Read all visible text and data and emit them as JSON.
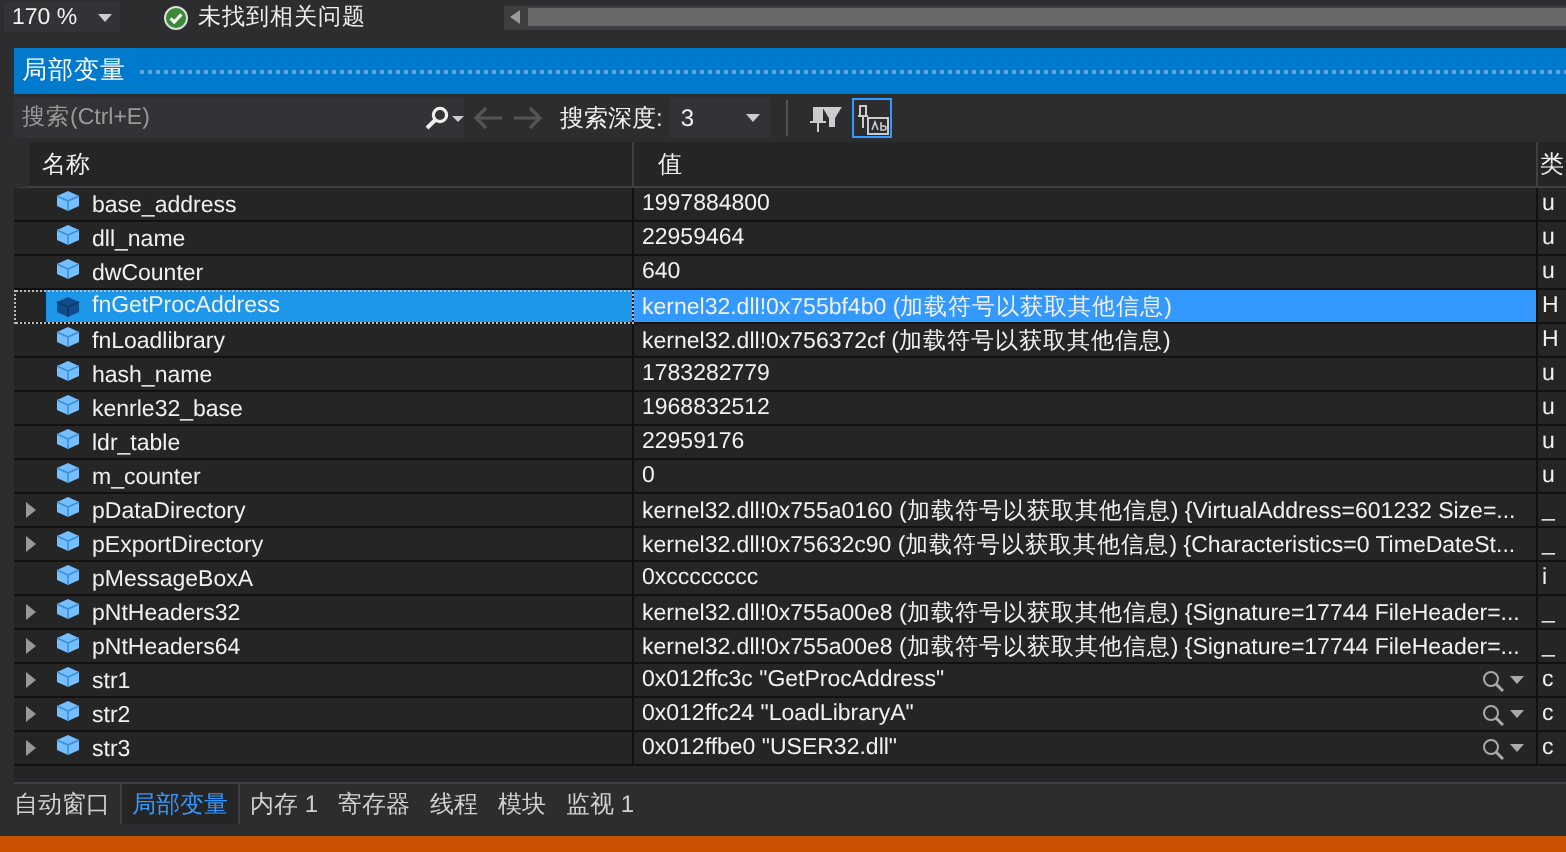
{
  "top_bar": {
    "zoom": "170 %",
    "status": "未找到相关问题"
  },
  "panel": {
    "title": "局部变量"
  },
  "toolbar": {
    "search_placeholder": "搜索(Ctrl+E)",
    "depth_label": "搜索深度:",
    "depth": "3",
    "view_buttons": [
      {
        "kind": "filter",
        "on": false
      },
      {
        "kind": "hex",
        "on": true
      }
    ]
  },
  "table": {
    "columns": [
      "名称",
      "值",
      "类"
    ],
    "rows": [
      {
        "name": "base_address",
        "value": "1997884800",
        "type": "u",
        "expandable": false,
        "selected": false,
        "visualizer": false
      },
      {
        "name": "dll_name",
        "value": "22959464",
        "type": "u",
        "expandable": false,
        "selected": false,
        "visualizer": false
      },
      {
        "name": "dwCounter",
        "value": "640",
        "type": "u",
        "expandable": false,
        "selected": false,
        "visualizer": false
      },
      {
        "name": "fnGetProcAddress",
        "value": "kernel32.dll!0x755bf4b0 (加载符号以获取其他信息)",
        "type": "H",
        "expandable": false,
        "selected": true,
        "visualizer": false
      },
      {
        "name": "fnLoadlibrary",
        "value": "kernel32.dll!0x756372cf (加载符号以获取其他信息)",
        "type": "H",
        "expandable": false,
        "selected": false,
        "visualizer": false
      },
      {
        "name": "hash_name",
        "value": "1783282779",
        "type": "u",
        "expandable": false,
        "selected": false,
        "visualizer": false
      },
      {
        "name": "kenrle32_base",
        "value": "1968832512",
        "type": "u",
        "expandable": false,
        "selected": false,
        "visualizer": false
      },
      {
        "name": "ldr_table",
        "value": "22959176",
        "type": "u",
        "expandable": false,
        "selected": false,
        "visualizer": false
      },
      {
        "name": "m_counter",
        "value": "0",
        "type": "u",
        "expandable": false,
        "selected": false,
        "visualizer": false
      },
      {
        "name": "pDataDirectory",
        "value": "kernel32.dll!0x755a0160 (加载符号以获取其他信息) {VirtualAddress=601232 Size=...",
        "type": "_",
        "expandable": true,
        "selected": false,
        "visualizer": false
      },
      {
        "name": "pExportDirectory",
        "value": "kernel32.dll!0x75632c90 (加载符号以获取其他信息) {Characteristics=0 TimeDateSt...",
        "type": "_",
        "expandable": true,
        "selected": false,
        "visualizer": false
      },
      {
        "name": "pMessageBoxA",
        "value": "0xcccccccc",
        "type": "i",
        "expandable": false,
        "selected": false,
        "visualizer": false
      },
      {
        "name": "pNtHeaders32",
        "value": "kernel32.dll!0x755a00e8 (加载符号以获取其他信息) {Signature=17744 FileHeader=...",
        "type": "_",
        "expandable": true,
        "selected": false,
        "visualizer": false
      },
      {
        "name": "pNtHeaders64",
        "value": "kernel32.dll!0x755a00e8 (加载符号以获取其他信息) {Signature=17744 FileHeader=...",
        "type": "_",
        "expandable": true,
        "selected": false,
        "visualizer": false
      },
      {
        "name": "str1",
        "value": "0x012ffc3c \"GetProcAddress\"",
        "type": "c",
        "expandable": true,
        "selected": false,
        "visualizer": true
      },
      {
        "name": "str2",
        "value": "0x012ffc24 \"LoadLibraryA\"",
        "type": "c",
        "expandable": true,
        "selected": false,
        "visualizer": true
      },
      {
        "name": "str3",
        "value": "0x012ffbe0 \"USER32.dll\"",
        "type": "c",
        "expandable": true,
        "selected": false,
        "visualizer": true
      }
    ]
  },
  "tabs": [
    {
      "label": "自动窗口",
      "selected": false
    },
    {
      "label": "局部变量",
      "selected": true
    },
    {
      "label": "内存 1",
      "selected": false
    },
    {
      "label": "寄存器",
      "selected": false
    },
    {
      "label": "线程",
      "selected": false
    },
    {
      "label": "模块",
      "selected": false
    },
    {
      "label": "监视 1",
      "selected": false
    }
  ]
}
